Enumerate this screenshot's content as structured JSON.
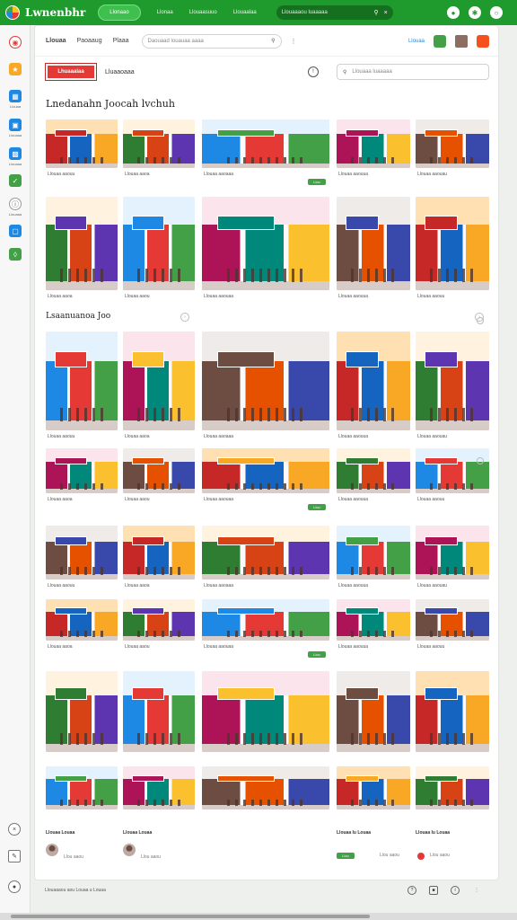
{
  "topbar": {
    "logo_text": "Lwnenbhr",
    "pill_label": "Llonaao",
    "links": [
      "Llonaa",
      "Llouaasuuo",
      "Llouaalaa"
    ],
    "search_placeholder": "Llouaaaou luaaaaa",
    "icons": [
      "bell-icon",
      "settings-icon",
      "profile-icon"
    ]
  },
  "rail": {
    "items": [
      {
        "icon": "home-icon",
        "label": "",
        "color": "#e53935"
      },
      {
        "icon": "star-icon",
        "label": "",
        "color": "#f9a825"
      },
      {
        "icon": "grid-icon",
        "label": "Llouaa",
        "color": "#1e88e5"
      },
      {
        "icon": "bag-icon",
        "label": "Llouaaa",
        "color": "#1e88e5"
      },
      {
        "icon": "store-icon",
        "label": "Llouaaa",
        "color": "#1e88e5"
      },
      {
        "icon": "check-icon",
        "label": "",
        "color": "#43a047"
      },
      {
        "icon": "info-icon",
        "label": "Llouaaa",
        "color": "#ffffff"
      },
      {
        "icon": "chat-icon",
        "label": "",
        "color": "#1e88e5"
      },
      {
        "icon": "tag-icon",
        "label": "",
        "color": "#43a047"
      }
    ],
    "bottom_icons": [
      "close-icon",
      "edit-icon",
      "user-icon"
    ]
  },
  "panel": {
    "tabs": [
      "Llouaa",
      "Paoaaug",
      "Plaaa"
    ],
    "search_placeholder": "Daouaad louauaa aaaa",
    "right_label": "Llouaa",
    "brand_badge": "Lhuaaaiaa",
    "sub_title": "Lluaaoaaa",
    "sub_search_placeholder": "Llouaaa luaaaaa",
    "section1_title": "Lnedanahn Joocah lvchuh",
    "section2_title": "Lsaanuanoa Joo",
    "captions_row1": [
      "Llouaa aaouu",
      "Llouaa aaoa",
      "Llouaa aaoaaa",
      "Llouaa aaouua",
      "Llouaa aaouau"
    ],
    "captions_row2": [
      "Llouaa aaoa",
      "Llouaa aaou",
      "Llouaa aaouaa",
      "Llouaa aaouua",
      "Llouaa aaouu"
    ],
    "pill_label": "Llou",
    "footer_cards": [
      {
        "name": "Llouaa Louaa",
        "meta": "Llou aaou"
      },
      {
        "name": "Llouaa Louaa",
        "meta": "Llou aaou"
      },
      {
        "name": "Llouaa lu Louaa",
        "meta": "Llou aaou"
      },
      {
        "name": "Llouaa lu Louaa",
        "meta": "Llou aaou"
      }
    ]
  },
  "footer": {
    "text": "Llouaaaou aou Louaa u Louaa",
    "icons": [
      "help-icon",
      "lock-icon",
      "info-icon",
      "more-icon"
    ]
  },
  "colors": {
    "brand_green": "#1f9a2d",
    "accent_red": "#e53935",
    "accent_blue": "#1e88e5"
  }
}
